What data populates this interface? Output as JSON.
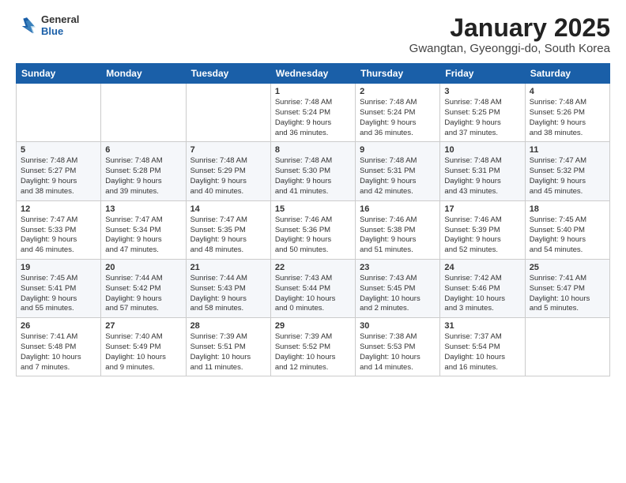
{
  "header": {
    "logo_general": "General",
    "logo_blue": "Blue",
    "title": "January 2025",
    "location": "Gwangtan, Gyeonggi-do, South Korea"
  },
  "weekdays": [
    "Sunday",
    "Monday",
    "Tuesday",
    "Wednesday",
    "Thursday",
    "Friday",
    "Saturday"
  ],
  "weeks": [
    [
      {
        "day": "",
        "info": ""
      },
      {
        "day": "",
        "info": ""
      },
      {
        "day": "",
        "info": ""
      },
      {
        "day": "1",
        "info": "Sunrise: 7:48 AM\nSunset: 5:24 PM\nDaylight: 9 hours\nand 36 minutes."
      },
      {
        "day": "2",
        "info": "Sunrise: 7:48 AM\nSunset: 5:24 PM\nDaylight: 9 hours\nand 36 minutes."
      },
      {
        "day": "3",
        "info": "Sunrise: 7:48 AM\nSunset: 5:25 PM\nDaylight: 9 hours\nand 37 minutes."
      },
      {
        "day": "4",
        "info": "Sunrise: 7:48 AM\nSunset: 5:26 PM\nDaylight: 9 hours\nand 38 minutes."
      }
    ],
    [
      {
        "day": "5",
        "info": "Sunrise: 7:48 AM\nSunset: 5:27 PM\nDaylight: 9 hours\nand 38 minutes."
      },
      {
        "day": "6",
        "info": "Sunrise: 7:48 AM\nSunset: 5:28 PM\nDaylight: 9 hours\nand 39 minutes."
      },
      {
        "day": "7",
        "info": "Sunrise: 7:48 AM\nSunset: 5:29 PM\nDaylight: 9 hours\nand 40 minutes."
      },
      {
        "day": "8",
        "info": "Sunrise: 7:48 AM\nSunset: 5:30 PM\nDaylight: 9 hours\nand 41 minutes."
      },
      {
        "day": "9",
        "info": "Sunrise: 7:48 AM\nSunset: 5:31 PM\nDaylight: 9 hours\nand 42 minutes."
      },
      {
        "day": "10",
        "info": "Sunrise: 7:48 AM\nSunset: 5:31 PM\nDaylight: 9 hours\nand 43 minutes."
      },
      {
        "day": "11",
        "info": "Sunrise: 7:47 AM\nSunset: 5:32 PM\nDaylight: 9 hours\nand 45 minutes."
      }
    ],
    [
      {
        "day": "12",
        "info": "Sunrise: 7:47 AM\nSunset: 5:33 PM\nDaylight: 9 hours\nand 46 minutes."
      },
      {
        "day": "13",
        "info": "Sunrise: 7:47 AM\nSunset: 5:34 PM\nDaylight: 9 hours\nand 47 minutes."
      },
      {
        "day": "14",
        "info": "Sunrise: 7:47 AM\nSunset: 5:35 PM\nDaylight: 9 hours\nand 48 minutes."
      },
      {
        "day": "15",
        "info": "Sunrise: 7:46 AM\nSunset: 5:36 PM\nDaylight: 9 hours\nand 50 minutes."
      },
      {
        "day": "16",
        "info": "Sunrise: 7:46 AM\nSunset: 5:38 PM\nDaylight: 9 hours\nand 51 minutes."
      },
      {
        "day": "17",
        "info": "Sunrise: 7:46 AM\nSunset: 5:39 PM\nDaylight: 9 hours\nand 52 minutes."
      },
      {
        "day": "18",
        "info": "Sunrise: 7:45 AM\nSunset: 5:40 PM\nDaylight: 9 hours\nand 54 minutes."
      }
    ],
    [
      {
        "day": "19",
        "info": "Sunrise: 7:45 AM\nSunset: 5:41 PM\nDaylight: 9 hours\nand 55 minutes."
      },
      {
        "day": "20",
        "info": "Sunrise: 7:44 AM\nSunset: 5:42 PM\nDaylight: 9 hours\nand 57 minutes."
      },
      {
        "day": "21",
        "info": "Sunrise: 7:44 AM\nSunset: 5:43 PM\nDaylight: 9 hours\nand 58 minutes."
      },
      {
        "day": "22",
        "info": "Sunrise: 7:43 AM\nSunset: 5:44 PM\nDaylight: 10 hours\nand 0 minutes."
      },
      {
        "day": "23",
        "info": "Sunrise: 7:43 AM\nSunset: 5:45 PM\nDaylight: 10 hours\nand 2 minutes."
      },
      {
        "day": "24",
        "info": "Sunrise: 7:42 AM\nSunset: 5:46 PM\nDaylight: 10 hours\nand 3 minutes."
      },
      {
        "day": "25",
        "info": "Sunrise: 7:41 AM\nSunset: 5:47 PM\nDaylight: 10 hours\nand 5 minutes."
      }
    ],
    [
      {
        "day": "26",
        "info": "Sunrise: 7:41 AM\nSunset: 5:48 PM\nDaylight: 10 hours\nand 7 minutes."
      },
      {
        "day": "27",
        "info": "Sunrise: 7:40 AM\nSunset: 5:49 PM\nDaylight: 10 hours\nand 9 minutes."
      },
      {
        "day": "28",
        "info": "Sunrise: 7:39 AM\nSunset: 5:51 PM\nDaylight: 10 hours\nand 11 minutes."
      },
      {
        "day": "29",
        "info": "Sunrise: 7:39 AM\nSunset: 5:52 PM\nDaylight: 10 hours\nand 12 minutes."
      },
      {
        "day": "30",
        "info": "Sunrise: 7:38 AM\nSunset: 5:53 PM\nDaylight: 10 hours\nand 14 minutes."
      },
      {
        "day": "31",
        "info": "Sunrise: 7:37 AM\nSunset: 5:54 PM\nDaylight: 10 hours\nand 16 minutes."
      },
      {
        "day": "",
        "info": ""
      }
    ]
  ]
}
